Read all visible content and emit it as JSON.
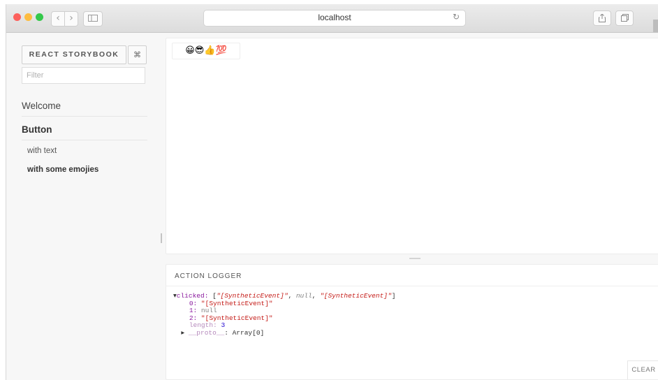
{
  "browser": {
    "address": "localhost",
    "traffic_lights": {
      "close": "#fc605c",
      "minimize": "#fdbc40",
      "maximize": "#34c84a"
    }
  },
  "sidebar": {
    "title": "REACT STORYBOOK",
    "shortcuts_label": "⌘",
    "filter_placeholder": "Filter",
    "kinds": [
      {
        "label": "Welcome"
      },
      {
        "label": "Button",
        "stories": [
          "with text",
          "with some emojies"
        ]
      }
    ],
    "selected_kind": "Button",
    "selected_story": "with some emojies"
  },
  "preview": {
    "button_label": "😀😎👍💯"
  },
  "action_logger": {
    "title": "ACTION LOGGER",
    "clear_label": "CLEAR",
    "log": {
      "action": "clicked",
      "summary_prefix": "[",
      "summary_items": [
        "\"[SyntheticEvent]\"",
        "null",
        "\"[SyntheticEvent]\""
      ],
      "summary_suffix": "]",
      "entries": [
        {
          "key": "0",
          "value": "\"[SyntheticEvent]\""
        },
        {
          "key": "1",
          "value": "null"
        },
        {
          "key": "2",
          "value": "\"[SyntheticEvent]\""
        }
      ],
      "length_key": "length",
      "length_value": "3",
      "proto_key": "__proto__",
      "proto_value": "Array[0]"
    }
  }
}
